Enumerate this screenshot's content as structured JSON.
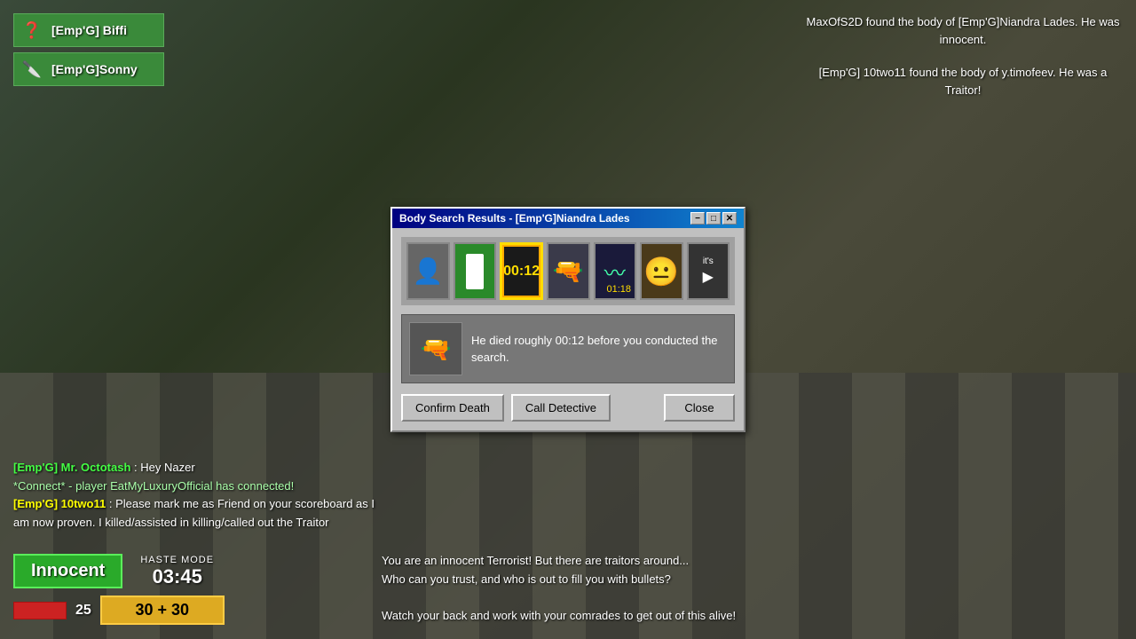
{
  "game": {
    "background_desc": "industrial game map"
  },
  "notifications": {
    "line1": "MaxOfS2D found the body of [Emp'G]Niandra Lades. He was innocent.",
    "line2": "[Emp'G] 10two11 found the body of y.timofeev. He was a Traitor!"
  },
  "players": [
    {
      "name": "[Emp'G] Biffi",
      "icon": "❓",
      "bg": "#3a8a3a"
    },
    {
      "name": "[Emp'G]Sonny",
      "icon": "🔪",
      "bg": "#3a8a3a"
    }
  ],
  "chat": [
    {
      "type": "player",
      "name": "[Emp'G] Mr. Octotash",
      "msg": " Hey Nazer",
      "name_color": "green"
    },
    {
      "type": "connect",
      "msg": "*Connect* - player EatMyLuxuryOfficial has connected!"
    },
    {
      "type": "player",
      "name": "[Emp'G] 10two11",
      "msg": ": Please mark me as Friend on your scoreboard as I am now proven. I killed/assisted in killing/called out the Traitor",
      "name_color": "yellow"
    }
  ],
  "hud": {
    "role": "Innocent",
    "haste_label": "HASTE MODE",
    "haste_time": "03:45",
    "health": "25",
    "ammo": "30 + 30"
  },
  "bottom_info": {
    "line1": "You are an innocent Terrorist! But there are traitors around...",
    "line2": "Who can you trust, and who is out to fill you with bullets?",
    "line3": "",
    "line4": "Watch your back and work with your comrades to get out of this alive!"
  },
  "modal": {
    "title": "Body Search Results - [Emp'G]Niandra Lades",
    "evidence": [
      {
        "type": "avatar",
        "label": "avatar"
      },
      {
        "type": "traitor_icon",
        "label": "traitor"
      },
      {
        "type": "timer",
        "value": "00:12",
        "label": "time_of_death",
        "selected": true
      },
      {
        "type": "weapon",
        "label": "weapon"
      },
      {
        "type": "dna",
        "value": "01:18",
        "label": "dna"
      },
      {
        "type": "suspect",
        "label": "suspect_face"
      },
      {
        "type": "its",
        "label": "its_video"
      }
    ],
    "death_text": "He died roughly 00:12 before you conducted the search.",
    "buttons": {
      "confirm": "Confirm Death",
      "detective": "Call Detective",
      "close": "Close"
    },
    "titlebar_buttons": [
      "-",
      "□",
      "✕"
    ]
  }
}
